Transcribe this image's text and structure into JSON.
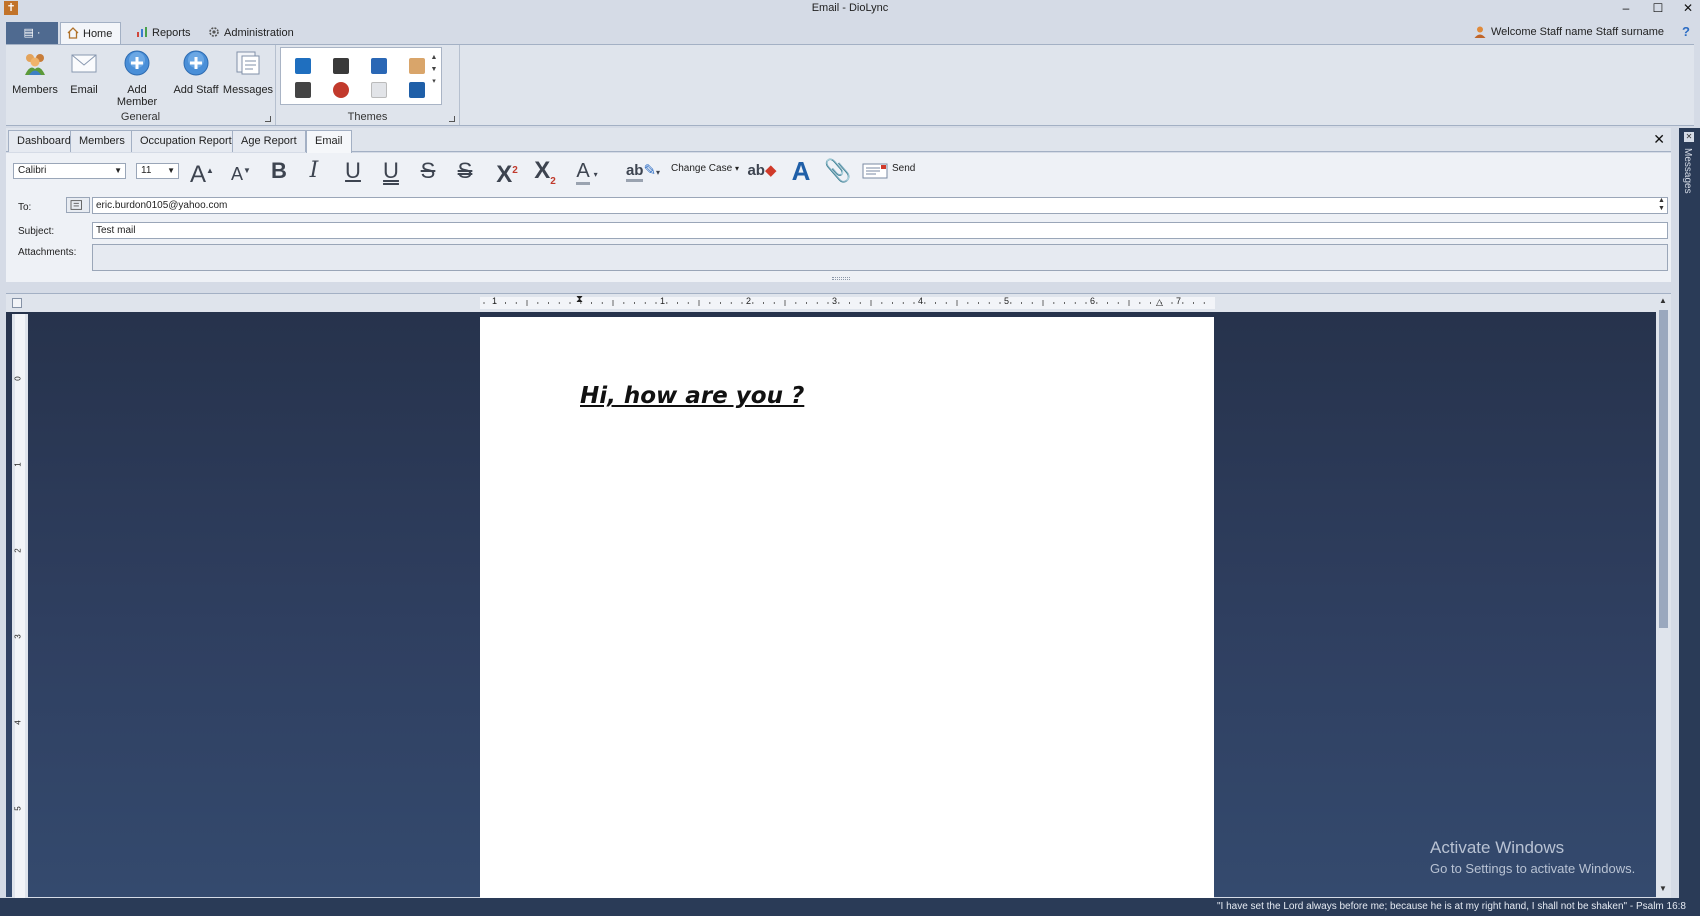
{
  "window": {
    "title": "Email - DioLync",
    "app_icon": "cross-icon",
    "minimize": "–",
    "maximize": "☐",
    "close": "✕"
  },
  "ribbon": {
    "app_menu_label": "▤ ·",
    "tabs": [
      {
        "label": "Home",
        "icon": "home-icon",
        "active": true
      },
      {
        "label": "Reports",
        "icon": "bar-chart-icon",
        "active": false
      },
      {
        "label": "Administration",
        "icon": "gear-icon",
        "active": false
      }
    ],
    "welcome_text": "Welcome Staff name Staff surname",
    "help": "?",
    "groups": {
      "general": {
        "label": "General",
        "buttons": [
          {
            "label": "Members",
            "icon": "members-icon"
          },
          {
            "label": "Email",
            "icon": "envelope-icon"
          },
          {
            "label": "Add Member",
            "icon": "plus-circle-icon"
          },
          {
            "label": "Add Staff",
            "icon": "plus-circle-icon"
          },
          {
            "label": "Messages",
            "icon": "messages-icon"
          }
        ]
      },
      "themes": {
        "label": "Themes"
      }
    }
  },
  "document_tabs": [
    {
      "label": "Dashboard",
      "active": false
    },
    {
      "label": "Members",
      "active": false
    },
    {
      "label": "Occupation Report",
      "active": false
    },
    {
      "label": "Age Report",
      "active": false
    },
    {
      "label": "Email",
      "active": true
    }
  ],
  "doc_close": "✕",
  "side_panel": {
    "label": "Messages"
  },
  "format_toolbar": {
    "font_name": "Calibri",
    "font_size": "11",
    "change_case_label": "Change Case",
    "send_label": "Send",
    "glyphs": {
      "grow": "A",
      "shrink": "A",
      "bold": "B",
      "italic": "I",
      "underline": "U",
      "double_underline": "U",
      "strike": "S",
      "double_strike": "S",
      "superscript": "X",
      "superscript_mark": "2",
      "subscript": "X",
      "subscript_mark": "2",
      "font_color": "A",
      "highlight": "ab",
      "clear_format": "ab",
      "font_dialog": "A"
    }
  },
  "email": {
    "to_label": "To:",
    "to_value": "eric.burdon0105@yahoo.com",
    "subject_label": "Subject:",
    "subject_value": "Test mail",
    "attachments_label": "Attachments:",
    "attachments_value": ""
  },
  "editor": {
    "ruler_numbers": [
      "1",
      "1",
      "2",
      "3",
      "4",
      "5",
      "6",
      "7"
    ],
    "v_ruler_numbers": [
      "0",
      "1",
      "2",
      "3",
      "4",
      "5"
    ],
    "body_text": "Hi, how are you ?"
  },
  "watermark": {
    "line1": "Activate Windows",
    "line2": "Go to Settings to activate Windows."
  },
  "status": {
    "text": "\"I have set the Lord always before me; because he is at my right hand, I shall not be shaken\" - Psalm 16:8"
  }
}
